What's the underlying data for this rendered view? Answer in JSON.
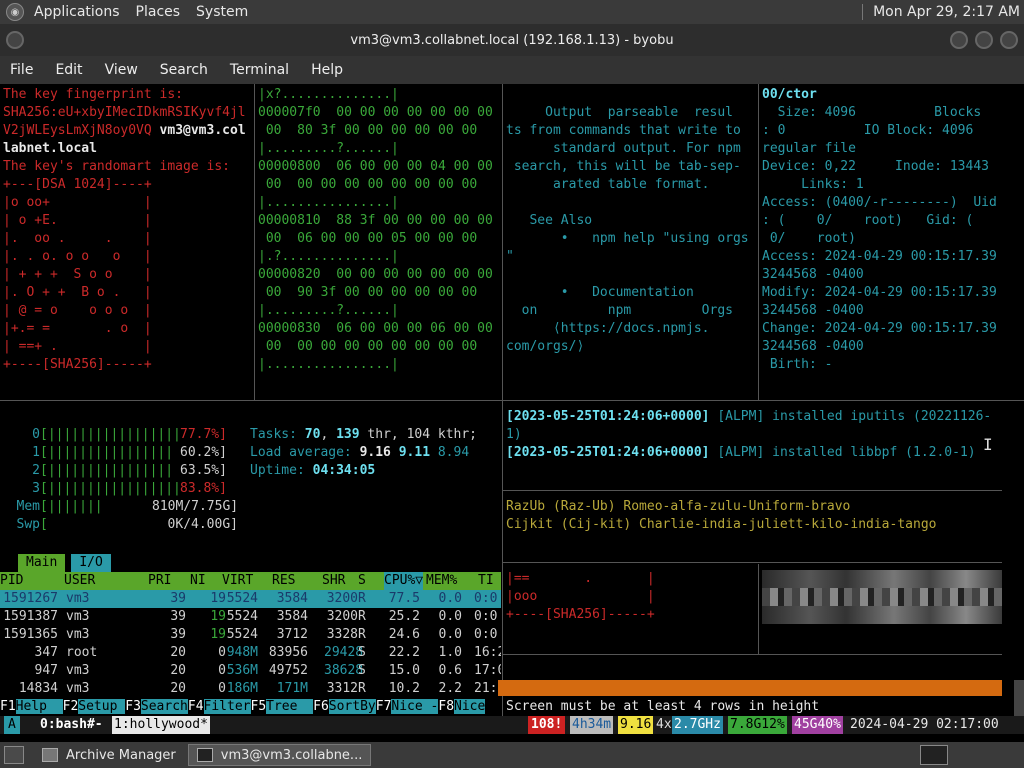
{
  "topbar": {
    "menus": [
      "Applications",
      "Places",
      "System"
    ],
    "clock": "Mon Apr 29,  2:17 AM"
  },
  "window": {
    "title": "vm3@vm3.collabnet.local (192.168.1.13) - byobu"
  },
  "menubar": [
    "File",
    "Edit",
    "View",
    "Search",
    "Terminal",
    "Help"
  ],
  "pane_ssh": {
    "lines": [
      "The key fingerprint is:",
      "SHA256:eU+xbyIMecIDkmRSIKyvf4jl",
      "V2jWLEysLmXjN8oy0VQ",
      "labnet.local",
      "The key's randomart image is:",
      "+---[DSA 1024]----+",
      "|o oo+            |",
      "| o +E.           |",
      "|.  oo .     .    |",
      "|. . o. o o   o   |",
      "| + + +  S o o    |",
      "|. O + +  B o .   |",
      "| @ = o    o o o  |",
      "|+.= =       . o  |",
      "| ==+ .           |",
      "+----[SHA256]-----+"
    ],
    "user_tail": "vm3@vm3.col"
  },
  "pane_hex": {
    "lines": [
      "|x?..............|",
      "000007f0  00 00 00 00 00 00 00",
      " 00  80 3f 00 00 00 00 00 00",
      "|.........?......|",
      "00000800  06 00 00 00 04 00 00",
      " 00  00 00 00 00 00 00 00 00",
      "|................|",
      "00000810  88 3f 00 00 00 00 00",
      " 00  06 00 00 00 05 00 00 00",
      "|.?..............|",
      "00000820  00 00 00 00 00 00 00",
      " 00  90 3f 00 00 00 00 00 00",
      "|.........?......|",
      "00000830  06 00 00 00 06 00 00",
      " 00  00 00 00 00 00 00 00 00",
      "|................|"
    ]
  },
  "pane_npm": {
    "lines": [
      "",
      "     Output  parseable  resul",
      "ts from commands that write to",
      "      standard output. For npm",
      " search, this will be tab-sep-",
      "      arated table format.",
      "",
      "   See Also",
      "       •   npm help \"using orgs",
      "\"",
      "",
      "       •   Documentation",
      "  on         npm         Orgs",
      "      ⟨https://docs.npmjs.",
      "com/orgs/⟩"
    ]
  },
  "pane_stat": {
    "lines": [
      "00/ctor",
      "  Size: 4096          Blocks",
      ": 0          IO Block: 4096",
      "regular file",
      "Device: 0,22     Inode: 13443",
      "     Links: 1",
      "Access: (0400/-r--------)  Uid",
      ": (    0/    root)   Gid: (",
      " 0/    root)",
      "Access: 2024-04-29 00:15:17.39",
      "3244568 -0400",
      "Modify: 2024-04-29 00:15:17.39",
      "3244568 -0400",
      "Change: 2024-04-29 00:15:17.39",
      "3244568 -0400",
      " Birth: -"
    ]
  },
  "htop": {
    "cpus": [
      {
        "id": "0",
        "bar": "[|||||||||||||||||",
        "pct": "77.7%]"
      },
      {
        "id": "1",
        "bar": "[|||||||||||||||| ",
        "pct": "60.2%]"
      },
      {
        "id": "2",
        "bar": "[|||||||||||||||| ",
        "pct": "63.5%]"
      },
      {
        "id": "3",
        "bar": "[|||||||||||||||||",
        "pct": "83.8%]"
      }
    ],
    "mem": {
      "label": "Mem",
      "bar": "[|||||||",
      "val": "810M/7.75G]"
    },
    "swp": {
      "label": "Swp",
      "bar": "[",
      "val": "0K/4.00G]"
    },
    "tasks_label": "Tasks:",
    "tasks": "70",
    "thr": "139",
    "thr_text": "thr,",
    "kthr": "104 kthr;",
    "load_label": "Load average:",
    "load1": "9.16",
    "load5": "9.11",
    "load15": "8.94",
    "uptime_label": "Uptime:",
    "uptime": "04:34:05",
    "tabs": [
      "Main",
      "I/O"
    ],
    "columns": [
      "PID",
      "USER",
      "PRI",
      "NI",
      "VIRT",
      "RES",
      "SHR",
      "S",
      "CPU%▽",
      "MEM%",
      "TI"
    ],
    "rows": [
      [
        "1591267",
        "vm3",
        "39",
        "19",
        "5524",
        "3584",
        "3200",
        "R",
        "77.5",
        "0.0",
        "0:0"
      ],
      [
        "1591387",
        "vm3",
        "39",
        "19",
        "5524",
        "3584",
        "3200",
        "R",
        "25.2",
        "0.0",
        "0:0"
      ],
      [
        "1591365",
        "vm3",
        "39",
        "19",
        "5524",
        "3712",
        "3328",
        "R",
        "24.6",
        "0.0",
        "0:0"
      ],
      [
        "347",
        "root",
        "20",
        "0",
        "948M",
        "83956",
        "29428",
        "S",
        "22.2",
        "1.0",
        "16:2"
      ],
      [
        "947",
        "vm3",
        "20",
        "0",
        "536M",
        "49752",
        "38628",
        "S",
        "15.0",
        "0.6",
        "17:0"
      ],
      [
        "14834",
        "vm3",
        "20",
        "0",
        "186M",
        "171M",
        "3312",
        "R",
        "10.2",
        "2.2",
        "21:3"
      ]
    ],
    "fkeys": [
      {
        "k": "F1",
        "l": "Help  "
      },
      {
        "k": "F2",
        "l": "Setup "
      },
      {
        "k": "F3",
        "l": "Search"
      },
      {
        "k": "F4",
        "l": "Filter"
      },
      {
        "k": "F5",
        "l": "Tree  "
      },
      {
        "k": "F6",
        "l": "SortBy"
      },
      {
        "k": "F7",
        "l": "Nice -"
      },
      {
        "k": "F8",
        "l": "Nice"
      }
    ]
  },
  "pane_log": {
    "lines": [
      {
        "ts": "[2023-05-25T01:24:06+0000]",
        "msg": " [ALPM] installed iputils (20221126-"
      },
      {
        "ts": "",
        "msg": "1)"
      },
      {
        "ts": "[2023-05-25T01:24:06+0000]",
        "msg": " [ALPM] installed libbpf (1.2.0-1)"
      }
    ]
  },
  "pane_names": {
    "lines": [
      "RazUb (Raz-Ub) Romeo-alfa-zulu-Uniform-bravo",
      "Cijkit (Cij-kit) Charlie-india-juliett-kilo-india-tango"
    ]
  },
  "pane_art2": {
    "lines": [
      "|==       .       |",
      "|ooo              |",
      "+----[SHA256]-----+"
    ]
  },
  "orange_msg": "Screen must be at least 4 rows in height",
  "byobu": {
    "win_a": " A ",
    "win0": "0:bash#-",
    "win1": "1:hollywood*",
    "updates": "108!",
    "uptime": "4h34m",
    "load": "9.16",
    "cpu_count": "4x",
    "cpu_freq": "2.7GHz",
    "mem": "7.8G12%",
    "disk": "45G40%",
    "datetime": "2024-04-29 02:17:00"
  },
  "taskbar": {
    "items": [
      "Archive Manager",
      "vm3@vm3.collabne..."
    ]
  },
  "colors": {
    "green_header": "#5aa62a",
    "cyan_select": "#2a9aa8",
    "orange_bar": "#d46a10"
  }
}
